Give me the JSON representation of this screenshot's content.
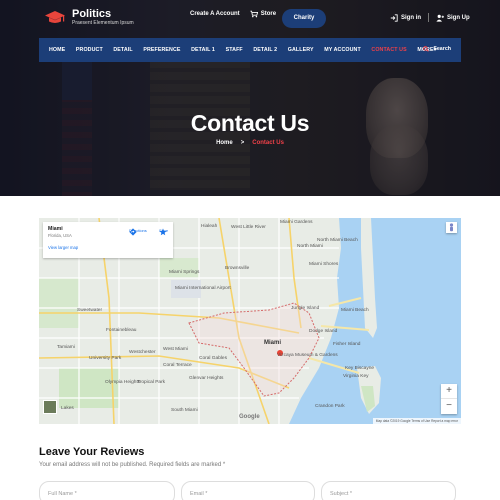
{
  "brand": {
    "title": "Politics",
    "subtitle": "Praesent Elementum Ipsum"
  },
  "top_links": {
    "create_account": "Create A Account",
    "store": "Store",
    "charity": "Charity",
    "sign_in": "Sign in",
    "sign_up": "Sign Up"
  },
  "nav": {
    "items": [
      "HOME",
      "PRODUCT",
      "DETAIL",
      "PREFERENCE",
      "DETAIL 1",
      "STAFF",
      "DETAIL 2",
      "GALLERY",
      "MY ACCOUNT",
      "CONTACT US",
      "MORE"
    ],
    "active": "CONTACT US",
    "search_label": "Search"
  },
  "hero": {
    "title": "Contact Us",
    "breadcrumb_home": "Home",
    "breadcrumb_arrow": ">",
    "breadcrumb_current": "Contact Us"
  },
  "map": {
    "card_title": "Miami",
    "card_subtitle": "Florida, USA",
    "card_link": "View larger map",
    "directions": "Directions",
    "save": "Save",
    "google": "Google",
    "attribution": "Map data ©2019 Google   Terms of Use   Report a map error",
    "labels": {
      "hialeah": "Hialeah",
      "west_little_river": "West Little River",
      "miami_gardens": "Miami Gardens",
      "north_miami_beach": "North Miami Beach",
      "north_miami": "North Miami",
      "miami_shores": "Miami Shores",
      "brownsville": "Brownsville",
      "miami_springs": "Miami Springs",
      "intl_airport": "Miami International Airport",
      "sweetwater": "Sweetwater",
      "fontainebleau": "Fontainebleau",
      "tamiami": "Tamiami",
      "university_park": "University Park",
      "westchester": "Westchester",
      "west_miami": "West Miami",
      "coral_terrace": "Coral Terrace",
      "coral_gables": "Coral Gables",
      "miami": "Miami",
      "miami_beach": "Miami Beach",
      "key_biscayne": "Key Biscayne",
      "olympia_heights": "Olympia Heights",
      "tropical_park": "Tropical Park",
      "glenvar_heights": "Glenvar Heights",
      "south_miami": "South Miami",
      "jungle_island": "Jungle Island",
      "dodge_island": "Dodge Island",
      "fisher_island": "Fisher Island",
      "virginia_key": "Virginia Key",
      "vizcaya": "Vizcaya Museum & Gardens",
      "crandon_park": "Crandon Park",
      "lakes": "Lakes"
    }
  },
  "reviews": {
    "title": "Leave Your Reviews",
    "note": "Your email address will not be published. Required fields are marked *",
    "full_name_placeholder": "Full Name *",
    "email_placeholder": "Email *",
    "subject_placeholder": "Subject *"
  },
  "colors": {
    "nav_bg": "#1c3e78",
    "accent": "#ef4048",
    "water": "#a9d2f3"
  },
  "icons": [
    "graduation-cap-icon",
    "user-icon",
    "cart-icon",
    "signin-icon",
    "user-plus-icon",
    "search-icon",
    "directions-icon",
    "star-icon",
    "pegman-icon"
  ]
}
